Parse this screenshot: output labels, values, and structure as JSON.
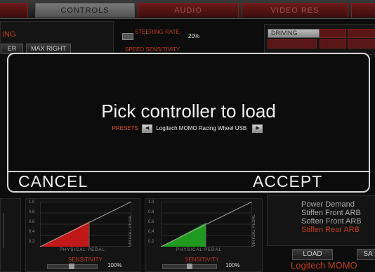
{
  "tabs": [
    {
      "label": "CONTROLS",
      "active": true
    },
    {
      "label": "AUDIO",
      "active": false
    },
    {
      "label": "VIDEO RES",
      "active": false
    }
  ],
  "background": {
    "left_title": "ING",
    "col_labels": [
      "ER",
      "MAX RIGHT"
    ],
    "steering_rate_label": "STEERING RATE",
    "steering_rate_value": "20%",
    "speed_sensitivity_label": "SPEED SENSITIVITY",
    "category_tabs": [
      "DRIVING"
    ],
    "pedal_axis_label": "VIRTUAL PEDAL",
    "pedal_x_label": "PHYSICAL PEDAL",
    "sensitivity_label": "SENSITIVITY",
    "sensitivity_value_1": "100%",
    "sensitivity_value_2": "100%",
    "graph_ticks": [
      "1.0",
      "0.8",
      "0.6",
      "0.4",
      "0.2"
    ],
    "list_items": [
      "Power Demand",
      "Stiffen Front ARB",
      "Soften Front ARB",
      "Stiffen Rear ARB"
    ],
    "load_label": "LOAD",
    "save_label": "SA",
    "controller_name_bg": "Logitech MOMO"
  },
  "modal": {
    "title": "Pick controller to load",
    "presets_label": "PRESETS",
    "preset_value": "Logitech MOMO Racing Wheel USB",
    "cancel_label": "CANCEL",
    "accept_label": "ACCEPT"
  },
  "colors": {
    "accent_red": "#c03a1e",
    "pedal_red": "#c01818",
    "pedal_green": "#1f9a1f"
  }
}
